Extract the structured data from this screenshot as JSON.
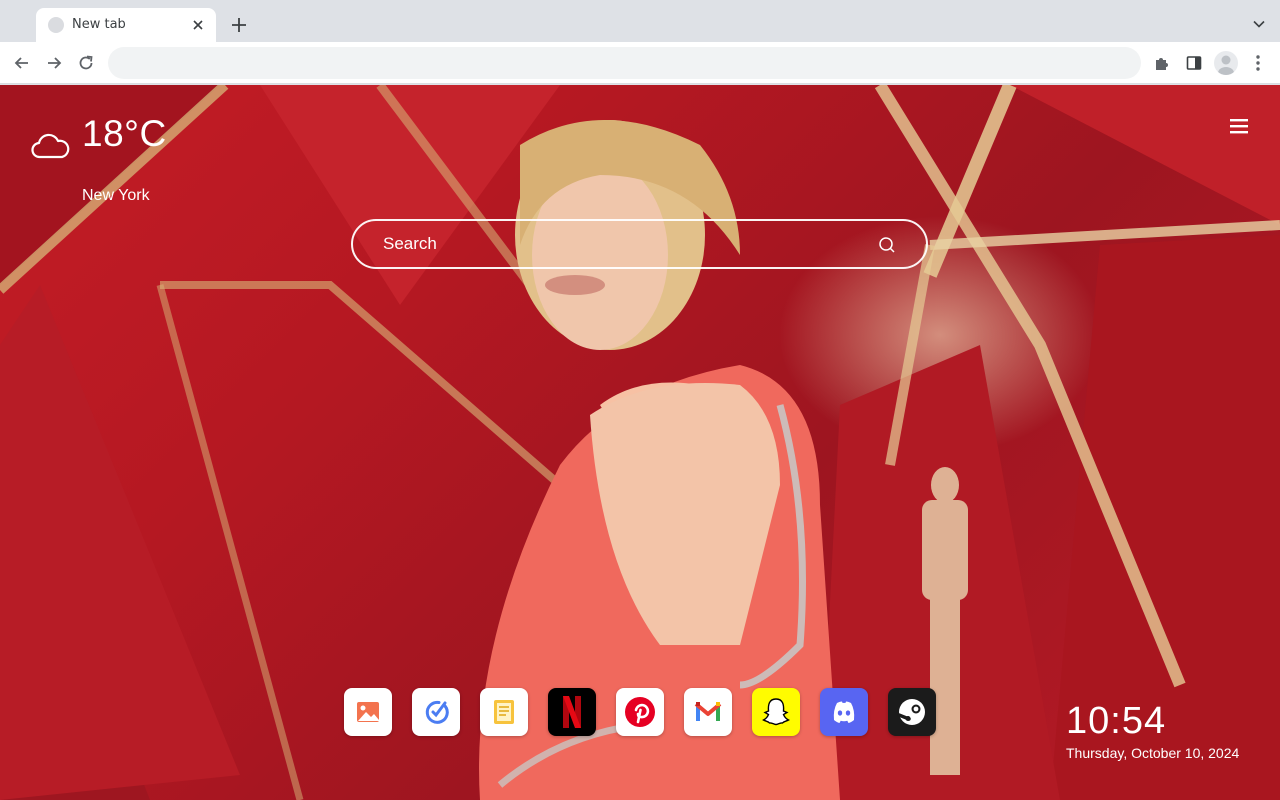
{
  "browser": {
    "tab": {
      "title": "New tab",
      "favicon": "blank-page-icon",
      "close_icon": "close-icon"
    },
    "new_tab_icon": "plus-icon",
    "tab_search_icon": "chevron-down-icon",
    "toolbar": {
      "back_icon": "arrow-left-icon",
      "forward_icon": "arrow-right-icon",
      "reload_icon": "reload-icon",
      "address_value": "",
      "extensions_icon": "puzzle-icon",
      "side_panel_icon": "side-panel-icon",
      "profile_icon": "person-icon",
      "menu_icon": "three-dots-icon"
    }
  },
  "page": {
    "weather": {
      "icon": "cloud-icon",
      "temperature": "18°C",
      "city": "New York"
    },
    "menu_icon": "hamburger-icon",
    "search": {
      "placeholder": "Search",
      "icon": "search-icon"
    },
    "apps": [
      {
        "name": "Photos",
        "icon": "image-icon",
        "bg": "#ffffff"
      },
      {
        "name": "Tasks",
        "icon": "check-circle-icon",
        "bg": "#ffffff"
      },
      {
        "name": "Notes",
        "icon": "notes-icon",
        "bg": "#ffffff"
      },
      {
        "name": "Netflix",
        "icon": "netflix-icon",
        "bg": "#000000"
      },
      {
        "name": "Pinterest",
        "icon": "pinterest-icon",
        "bg": "#ffffff"
      },
      {
        "name": "Gmail",
        "icon": "gmail-icon",
        "bg": "#ffffff"
      },
      {
        "name": "Snapchat",
        "icon": "snapchat-icon",
        "bg": "#fffc00"
      },
      {
        "name": "Discord",
        "icon": "discord-icon",
        "bg": "#5865f2"
      },
      {
        "name": "Steam",
        "icon": "steam-icon",
        "bg": "#1b1b1b"
      }
    ],
    "clock": {
      "time": "10:54",
      "date": "Thursday, October 10, 2024"
    },
    "colors": {
      "background_red": "#b51822",
      "accent_gold": "#d8b77a",
      "dress_coral": "#f16a5e"
    }
  }
}
